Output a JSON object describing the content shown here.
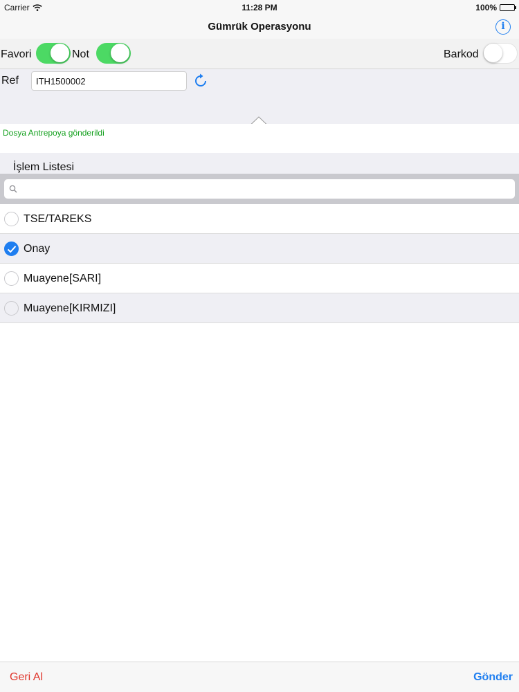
{
  "status_bar": {
    "carrier": "Carrier",
    "time": "11:28 PM",
    "battery": "100%"
  },
  "nav": {
    "title": "Gümrük Operasyonu",
    "info_icon": "info-icon",
    "info_glyph": "i"
  },
  "options": {
    "favori_label": "Favori",
    "favori_on": true,
    "not_label": "Not",
    "not_on": true,
    "barkod_label": "Barkod",
    "barkod_on": false
  },
  "ref": {
    "label": "Ref",
    "value": "ITH1500002"
  },
  "message": "Dosya Antrepoya gönderildi",
  "list": {
    "title": "İşlem Listesi",
    "search_placeholder": "",
    "items": [
      {
        "label": "TSE/TAREKS",
        "checked": false
      },
      {
        "label": "Onay",
        "checked": true
      },
      {
        "label": "Muayene[SARI]",
        "checked": false
      },
      {
        "label": "Muayene[KIRMIZI]",
        "checked": false
      }
    ]
  },
  "footer": {
    "undo_label": "Geri Al",
    "send_label": "Gönder"
  },
  "colors": {
    "accent": "#1e7ef0",
    "toggle_on": "#4cd964",
    "success_text": "#14a01e",
    "destructive": "#e0352b"
  }
}
